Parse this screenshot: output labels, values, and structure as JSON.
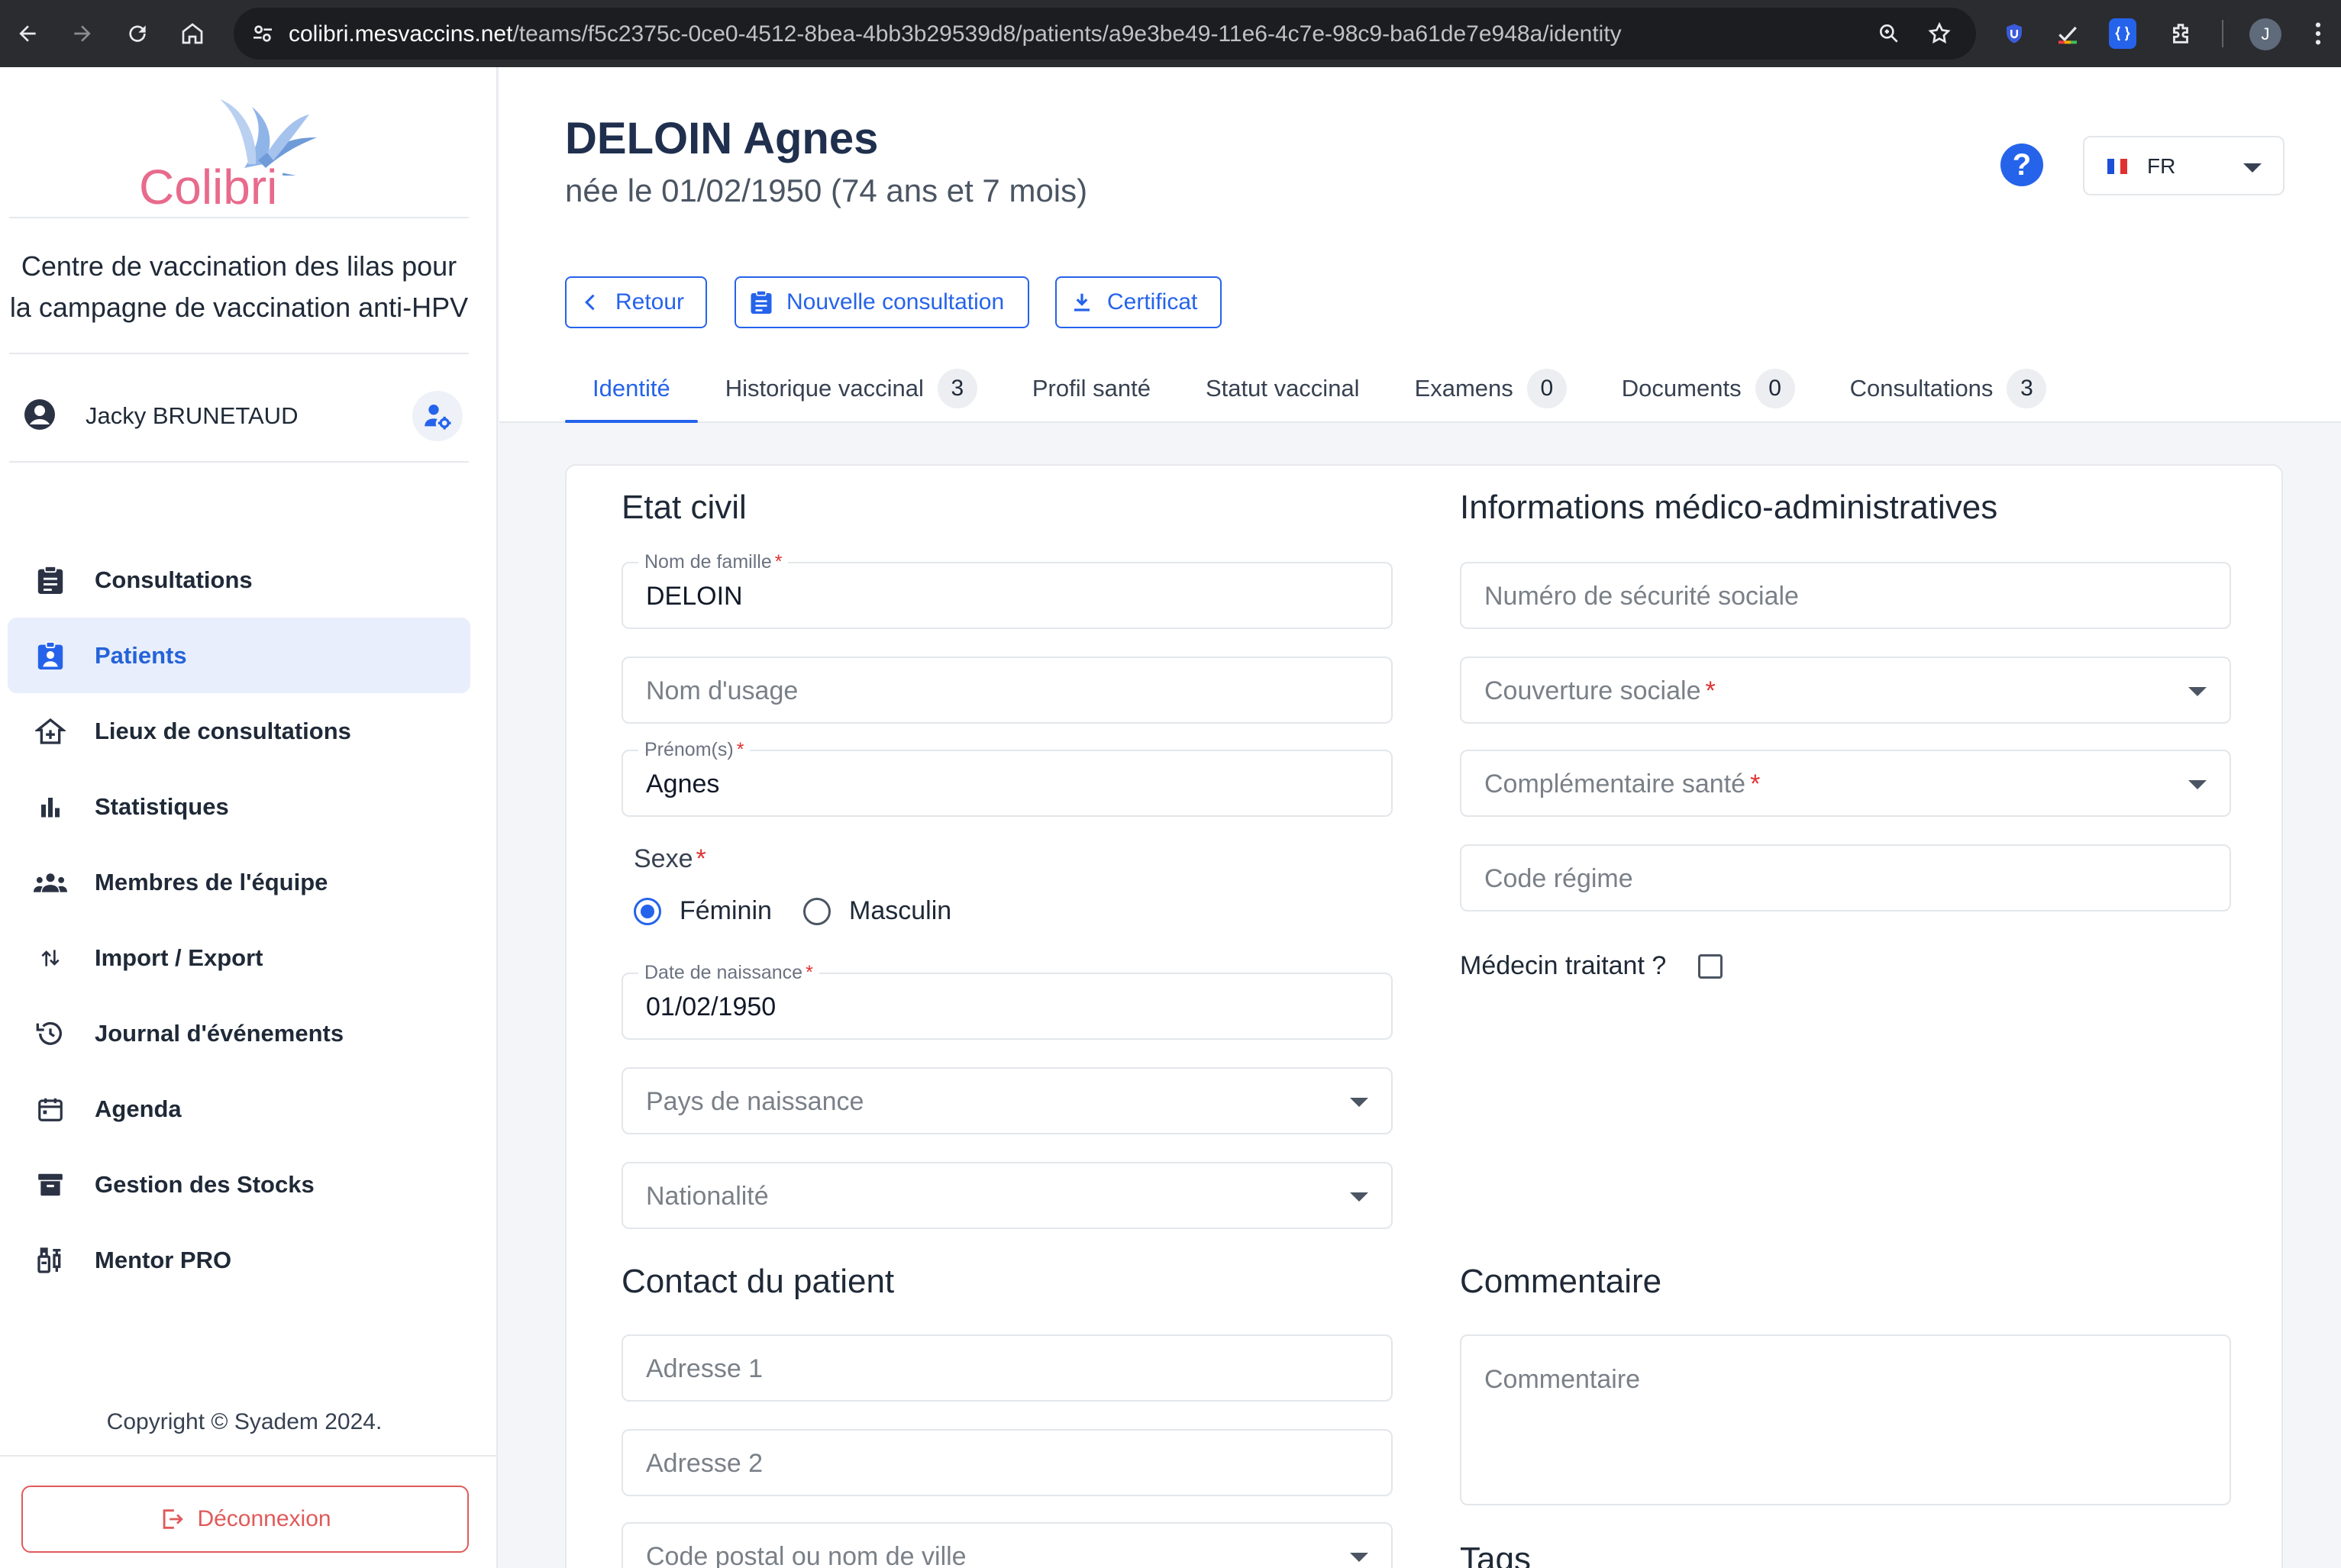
{
  "browser": {
    "url_host": "colibri.mesvaccins.net",
    "url_path": "/teams/f5c2375c-0ce0-4512-8bea-4bb3b29539d8/patients/a9e3be49-11e6-4c7e-98c9-ba61de7e948a/identity",
    "profile_initial": "J"
  },
  "sidebar": {
    "logo_text": "Colibri",
    "center_name_line1": "Centre de vaccination des lilas pour",
    "center_name_line2": "la campagne de vaccination anti-HPV",
    "user_name": "Jacky BRUNETAUD",
    "menu": [
      {
        "label": "Consultations",
        "icon": "clipboard-icon"
      },
      {
        "label": "Patients",
        "icon": "patient-badge-icon",
        "active": true
      },
      {
        "label": "Lieux de consultations",
        "icon": "home-plus-icon"
      },
      {
        "label": "Statistiques",
        "icon": "bar-chart-icon"
      },
      {
        "label": "Membres de l'équipe",
        "icon": "group-icon"
      },
      {
        "label": "Import / Export",
        "icon": "swap-vert-icon"
      },
      {
        "label": "Journal d'événements",
        "icon": "history-icon"
      },
      {
        "label": "Agenda",
        "icon": "calendar-icon"
      },
      {
        "label": "Gestion des Stocks",
        "icon": "archive-icon"
      },
      {
        "label": "Mentor PRO",
        "icon": "vaccine-icon"
      }
    ],
    "copyright": "Copyright © Syadem 2024.",
    "logout_label": "Déconnexion"
  },
  "header": {
    "patient_name": "DELOIN Agnes",
    "patient_sub": "née le 01/02/1950 (74 ans et 7 mois)",
    "help_label": "?",
    "language": "FR",
    "actions": {
      "back": "Retour",
      "new_consultation": "Nouvelle consultation",
      "certificate": "Certificat"
    },
    "tabs": [
      {
        "label": "Identité",
        "active": true
      },
      {
        "label": "Historique vaccinal",
        "badge": "3"
      },
      {
        "label": "Profil santé"
      },
      {
        "label": "Statut vaccinal"
      },
      {
        "label": "Examens",
        "badge": "0"
      },
      {
        "label": "Documents",
        "badge": "0"
      },
      {
        "label": "Consultations",
        "badge": "3"
      }
    ]
  },
  "form": {
    "etat_civil": {
      "title": "Etat civil",
      "nom_famille_label": "Nom de famille",
      "nom_famille_value": "DELOIN",
      "nom_usage_placeholder": "Nom d'usage",
      "prenoms_label": "Prénom(s)",
      "prenoms_value": "Agnes",
      "sexe_label": "Sexe",
      "sexe_options": [
        "Féminin",
        "Masculin"
      ],
      "sexe_selected": "Féminin",
      "date_naissance_label": "Date de naissance",
      "date_naissance_value": "01/02/1950",
      "pays_naissance_placeholder": "Pays de naissance",
      "nationalite_placeholder": "Nationalité"
    },
    "medico_admin": {
      "title": "Informations médico-administratives",
      "secu_placeholder": "Numéro de sécurité sociale",
      "couverture_placeholder": "Couverture sociale",
      "complementaire_placeholder": "Complémentaire santé",
      "code_regime_placeholder": "Code régime",
      "medecin_traitant_label": "Médecin traitant ?",
      "medecin_traitant_checked": false
    },
    "contact": {
      "title": "Contact du patient",
      "adresse1_placeholder": "Adresse 1",
      "adresse2_placeholder": "Adresse 2",
      "ville_placeholder": "Code postal ou nom de ville"
    },
    "commentaire": {
      "title": "Commentaire",
      "placeholder": "Commentaire"
    },
    "tags": {
      "title": "Tags"
    },
    "required_mark": "*"
  },
  "colors": {
    "accent": "#2563eb",
    "danger": "#e05a5a",
    "required": "#e03131"
  }
}
